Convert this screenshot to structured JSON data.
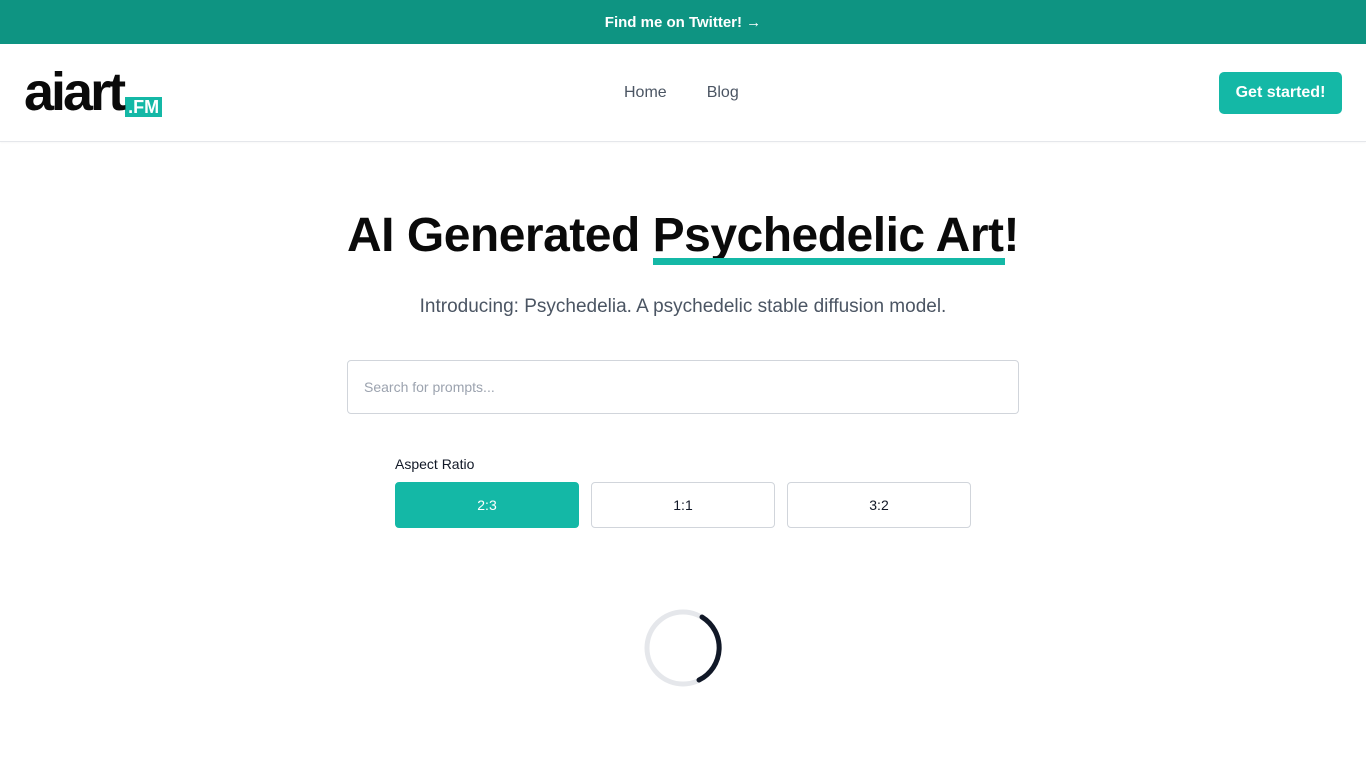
{
  "announcement": {
    "text": "Find me on Twitter! →"
  },
  "logo": {
    "main": "aiart",
    "tag": ".FM"
  },
  "nav": {
    "links": [
      "Home",
      "Blog"
    ]
  },
  "cta": {
    "label": "Get started!"
  },
  "hero": {
    "title_prefix": "AI Generated ",
    "title_highlight": "Psychedelic Art!",
    "subtitle": "Introducing: Psychedelia. A psychedelic stable diffusion model."
  },
  "search": {
    "placeholder": "Search for prompts...",
    "value": ""
  },
  "aspect": {
    "label": "Aspect Ratio",
    "options": [
      "2:3",
      "1:1",
      "3:2"
    ],
    "selected": "2:3"
  },
  "colors": {
    "accent": "#14b8a6",
    "banner": "#0e9482",
    "spinner": "#111827"
  },
  "icons": {
    "loading": "loading-spinner-icon"
  }
}
